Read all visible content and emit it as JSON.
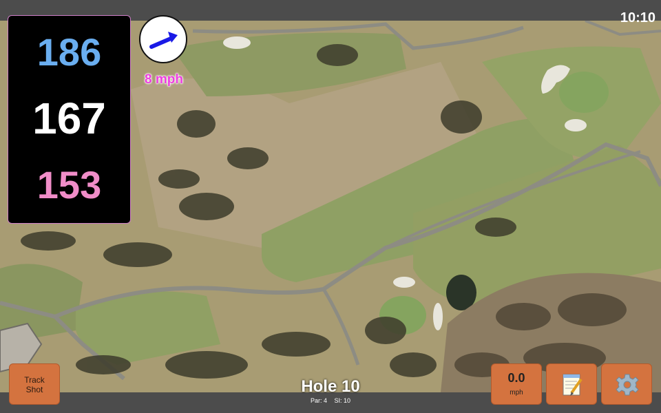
{
  "status_bar": {
    "clock": "10:10"
  },
  "yardages": {
    "back": "186",
    "center": "167",
    "front": "153"
  },
  "wind": {
    "speed_label": "8 mph",
    "direction_icon": "arrow-up-right-icon"
  },
  "hole": {
    "title": "Hole 10",
    "par_label": "Par: 4",
    "si_label": "SI: 10"
  },
  "buttons": {
    "track_shot_line1": "Track",
    "track_shot_line2": "Shot",
    "speed_value": "0.0",
    "speed_unit": "mph",
    "notes_icon": "notepad-icon",
    "settings_icon": "gear-icon"
  },
  "colors": {
    "back_yardage": "#6aaef0",
    "center_yardage": "#ffffff",
    "front_yardage": "#f08dc8",
    "wind_label": "#ee3fe0",
    "button": "#d4733f"
  }
}
